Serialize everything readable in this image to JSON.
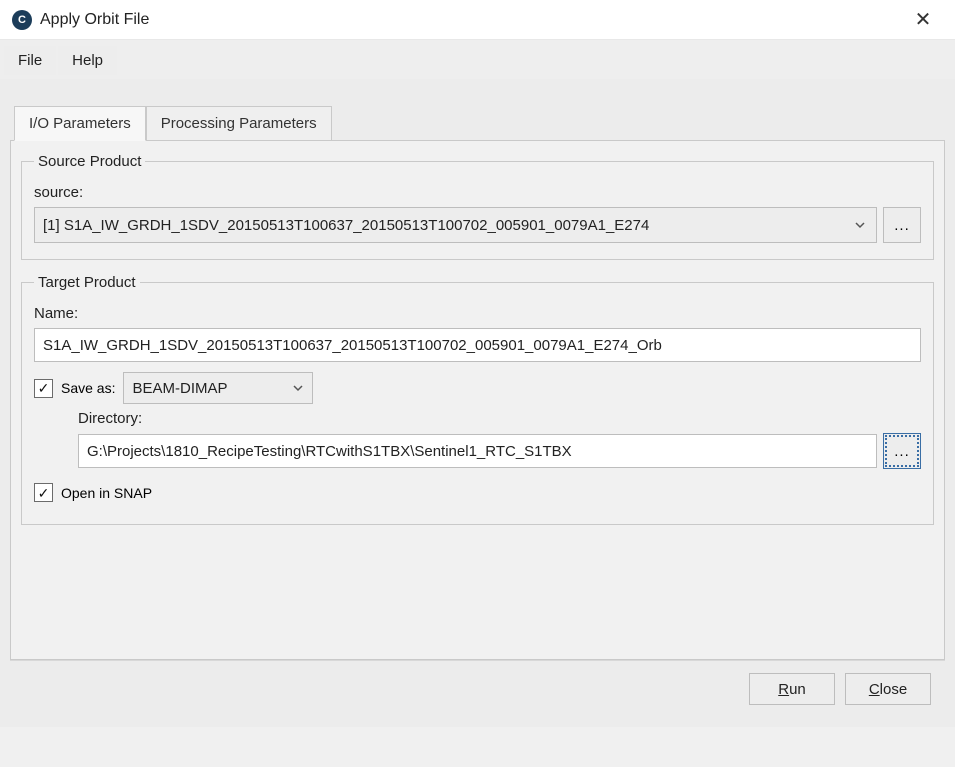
{
  "titlebar": {
    "title": "Apply Orbit File"
  },
  "menu": {
    "file": "File",
    "help": "Help"
  },
  "tabs": {
    "io": "I/O Parameters",
    "processing": "Processing Parameters"
  },
  "source_group": {
    "legend": "Source Product",
    "label": "source:",
    "value": "[1] S1A_IW_GRDH_1SDV_20150513T100637_20150513T100702_005901_0079A1_E274",
    "browse": "..."
  },
  "target_group": {
    "legend": "Target Product",
    "name_label": "Name:",
    "name_value": "S1A_IW_GRDH_1SDV_20150513T100637_20150513T100702_005901_0079A1_E274_Orb",
    "saveas_label": "Save as:",
    "saveas_format": "BEAM-DIMAP",
    "directory_label": "Directory:",
    "directory_value": "G:\\Projects\\1810_RecipeTesting\\RTCwithS1TBX\\Sentinel1_RTC_S1TBX",
    "directory_browse": "...",
    "open_in_snap": "Open in SNAP"
  },
  "footer": {
    "run_prefix": "R",
    "run_suffix": "un",
    "close_prefix": "C",
    "close_suffix": "lose"
  }
}
